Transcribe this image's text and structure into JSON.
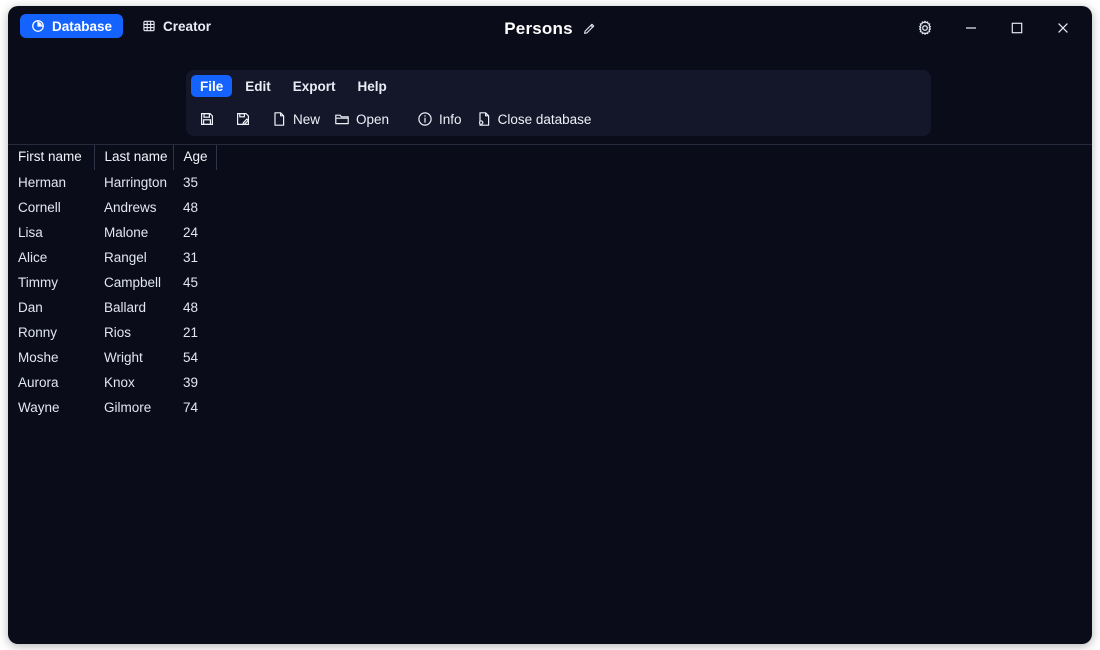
{
  "window": {
    "title": "Persons",
    "title_edit_icon": "pencil-icon",
    "controls": {
      "settings": "gear-icon",
      "minimize": "minimize-icon",
      "maximize": "maximize-icon",
      "close": "close-icon"
    }
  },
  "nav": {
    "items": [
      {
        "label": "Database",
        "icon": "pie-chart-icon",
        "active": true
      },
      {
        "label": "Creator",
        "icon": "grid-table-icon",
        "active": false
      }
    ]
  },
  "menu": {
    "items": [
      {
        "label": "File",
        "active": true
      },
      {
        "label": "Edit",
        "active": false
      },
      {
        "label": "Export",
        "active": false
      },
      {
        "label": "Help",
        "active": false
      }
    ]
  },
  "toolbar": {
    "actions": [
      {
        "label": "",
        "icon": "save-icon"
      },
      {
        "label": "",
        "icon": "save-as-icon"
      },
      {
        "label": "New",
        "icon": "new-file-icon"
      },
      {
        "label": "Open",
        "icon": "open-folder-icon"
      },
      {
        "label": "Info",
        "icon": "info-circle-icon"
      },
      {
        "label": "Close database",
        "icon": "close-database-icon"
      }
    ]
  },
  "table": {
    "columns": [
      "First name",
      "Last name",
      "Age"
    ],
    "rows": [
      [
        "Herman",
        "Harrington",
        "35"
      ],
      [
        "Cornell",
        "Andrews",
        "48"
      ],
      [
        "Lisa",
        "Malone",
        "24"
      ],
      [
        "Alice",
        "Rangel",
        "31"
      ],
      [
        "Timmy",
        "Campbell",
        "45"
      ],
      [
        "Dan",
        "Ballard",
        "48"
      ],
      [
        "Ronny",
        "Rios",
        "21"
      ],
      [
        "Moshe",
        "Wright",
        "54"
      ],
      [
        "Aurora",
        "Knox",
        "39"
      ],
      [
        "Wayne",
        "Gilmore",
        "74"
      ]
    ]
  },
  "colors": {
    "accent": "#1463ff",
    "window_bg": "#0b0c1a",
    "panel_bg": "#141729",
    "text": "#e9ecf5",
    "rule": "#2f3449"
  }
}
